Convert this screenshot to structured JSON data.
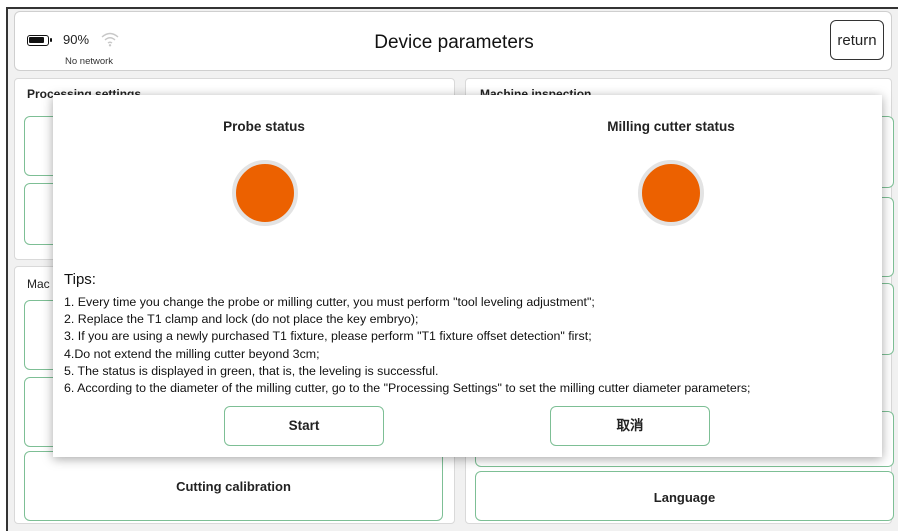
{
  "header": {
    "battery_pct": "90%",
    "network_status": "No network",
    "title": "Device parameters",
    "return_label": "return"
  },
  "background": {
    "sections": {
      "processing": "Processing settings",
      "inspection": "Machine inspection",
      "machine": "Mac"
    },
    "buttons": {
      "cutting_calibration": "Cutting calibration",
      "language": "Language"
    }
  },
  "modal": {
    "probe_status_label": "Probe status",
    "cutter_status_label": "Milling cutter status",
    "tips_heading": "Tips:",
    "tips": [
      "1. Every time you change the probe or milling cutter, you must perform \"tool leveling adjustment\";",
      "2. Replace the T1 clamp and lock (do not place the key embryo);",
      "3. If you are using a newly purchased T1 fixture, please perform \"T1 fixture offset detection\" first;",
      "4.Do not extend the milling cutter beyond 3cm;",
      "5. The status is displayed in green, that is, the leveling is successful.",
      "6. According to the diameter of the milling cutter, go to the \"Processing Settings\" to set the milling cutter diameter parameters;"
    ],
    "start_label": "Start",
    "cancel_label": "取消"
  },
  "colors": {
    "indicator": "#ec6100",
    "button_border": "#7dbf95"
  }
}
